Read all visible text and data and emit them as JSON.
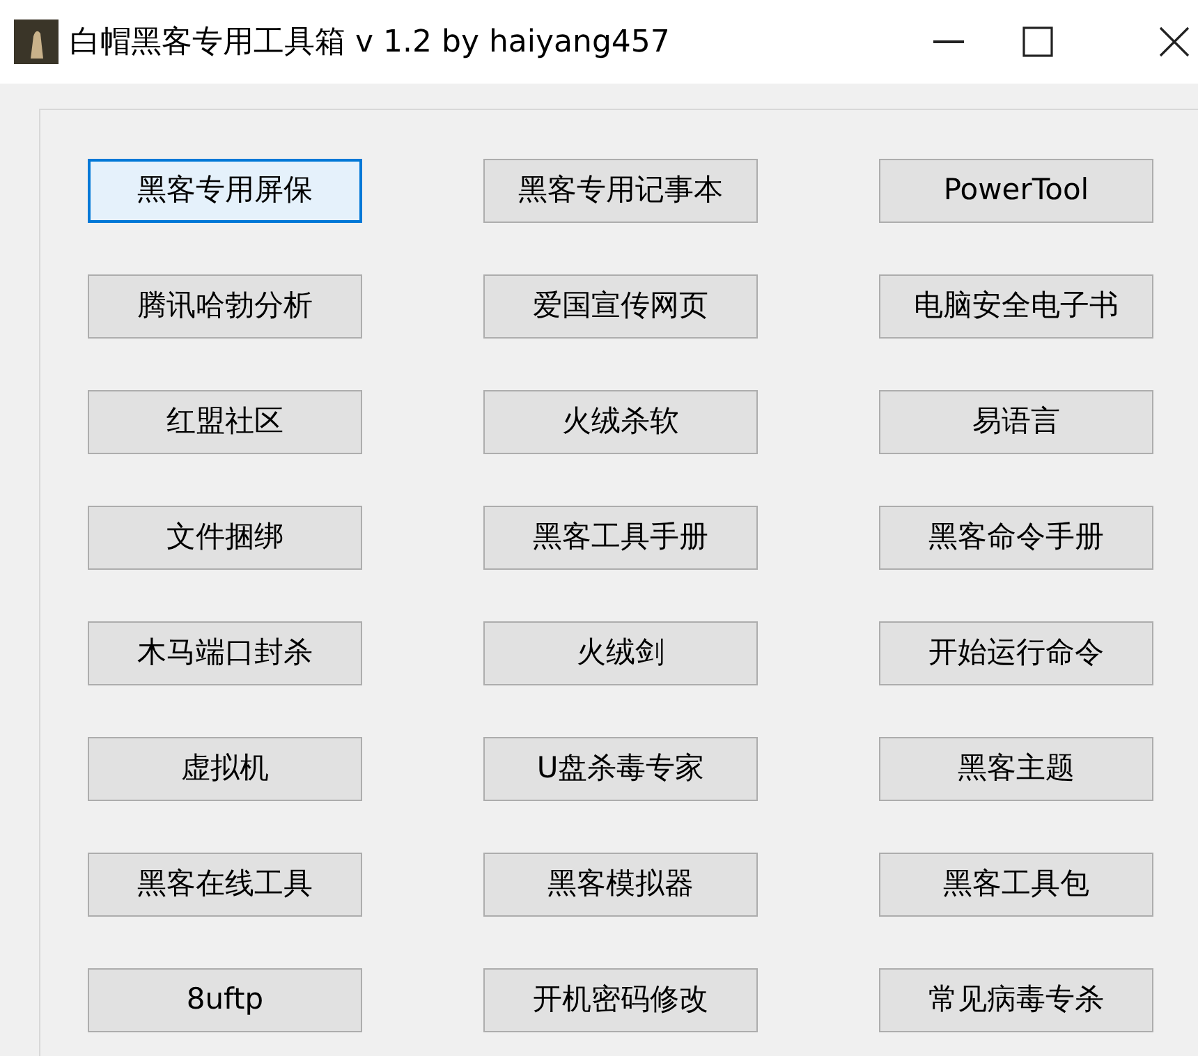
{
  "window": {
    "title": "白帽黑客专用工具箱 v 1.2  by haiyang457"
  },
  "buttons": [
    {
      "label": "黑客专用屏保",
      "focused": true
    },
    {
      "label": "黑客专用记事本",
      "focused": false
    },
    {
      "label": "PowerTool",
      "focused": false
    },
    {
      "label": "腾讯哈勃分析",
      "focused": false
    },
    {
      "label": "爱国宣传网页",
      "focused": false
    },
    {
      "label": "电脑安全电子书",
      "focused": false
    },
    {
      "label": "红盟社区",
      "focused": false
    },
    {
      "label": "火绒杀软",
      "focused": false
    },
    {
      "label": "易语言",
      "focused": false
    },
    {
      "label": "文件捆绑",
      "focused": false
    },
    {
      "label": "黑客工具手册",
      "focused": false
    },
    {
      "label": "黑客命令手册",
      "focused": false
    },
    {
      "label": "木马端口封杀",
      "focused": false
    },
    {
      "label": "火绒剑",
      "focused": false
    },
    {
      "label": "开始运行命令",
      "focused": false
    },
    {
      "label": "虚拟机",
      "focused": false
    },
    {
      "label": "U盘杀毒专家",
      "focused": false
    },
    {
      "label": "黑客主题",
      "focused": false
    },
    {
      "label": "黑客在线工具",
      "focused": false
    },
    {
      "label": "黑客模拟器",
      "focused": false
    },
    {
      "label": "黑客工具包",
      "focused": false
    },
    {
      "label": "8uftp",
      "focused": false
    },
    {
      "label": "开机密码修改",
      "focused": false
    },
    {
      "label": "常见病毒专杀",
      "focused": false
    }
  ]
}
